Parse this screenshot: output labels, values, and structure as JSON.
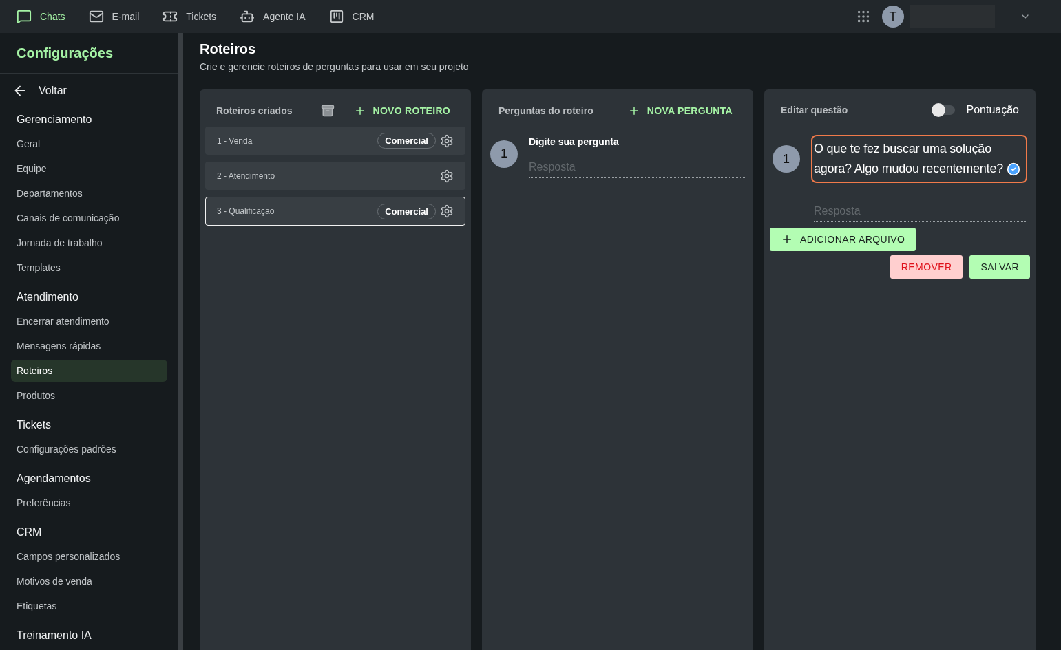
{
  "topnav": [
    {
      "kind": "chats",
      "label": "Chats",
      "selected": true
    },
    {
      "kind": "email",
      "label": "E-mail",
      "selected": false
    },
    {
      "kind": "tickets",
      "label": "Tickets",
      "selected": false
    },
    {
      "kind": "agent",
      "label": "Agente IA",
      "selected": false
    },
    {
      "kind": "crm",
      "label": "CRM",
      "selected": false
    }
  ],
  "user": {
    "initial": "T"
  },
  "sidebar": {
    "title": "Configurações",
    "back": "Voltar",
    "sections": [
      {
        "title": "Gerenciamento",
        "items": [
          {
            "label": "Geral",
            "selected": false
          },
          {
            "label": "Equipe",
            "selected": false
          },
          {
            "label": "Departamentos",
            "selected": false
          },
          {
            "label": "Canais de comunicação",
            "selected": false
          },
          {
            "label": "Jornada de trabalho",
            "selected": false
          },
          {
            "label": "Templates",
            "selected": false
          }
        ]
      },
      {
        "title": "Atendimento",
        "items": [
          {
            "label": "Encerrar atendimento",
            "selected": false
          },
          {
            "label": "Mensagens rápidas",
            "selected": false
          },
          {
            "label": "Roteiros",
            "selected": true
          },
          {
            "label": "Produtos",
            "selected": false
          }
        ]
      },
      {
        "title": "Tickets",
        "items": [
          {
            "label": "Configurações padrões",
            "selected": false
          }
        ]
      },
      {
        "title": "Agendamentos",
        "items": [
          {
            "label": "Preferências",
            "selected": false
          }
        ]
      },
      {
        "title": "CRM",
        "items": [
          {
            "label": "Campos personalizados",
            "selected": false
          },
          {
            "label": "Motivos de venda",
            "selected": false
          },
          {
            "label": "Etiquetas",
            "selected": false
          }
        ]
      },
      {
        "title": "Treinamento IA"
      }
    ]
  },
  "page": {
    "title": "Roteiros",
    "subtitle": "Crie e gerencie roteiros de perguntas para usar em seu projeto"
  },
  "scripts_panel": {
    "title": "Roteiros criados",
    "add": "NOVO ROTEIRO",
    "items": [
      {
        "label": "1 - Venda",
        "tag": "Comercial",
        "selected": false
      },
      {
        "label": "2 - Atendimento",
        "selected": false
      },
      {
        "label": "3 - Qualificação",
        "tag": "Comercial",
        "selected": true
      }
    ]
  },
  "questions_panel": {
    "title": "Perguntas do roteiro",
    "add": "NOVA PERGUNTA",
    "questions": [
      {
        "number": "1",
        "question": "Digite sua pergunta",
        "answer_placeholder": "Resposta"
      }
    ]
  },
  "edit_panel": {
    "title": "Editar questão",
    "toggle": {
      "label": "Pontuação",
      "on": false
    },
    "number": "1",
    "question": "O que te fez buscar uma solução agora? Algo mudou recentemente?",
    "answer_placeholder": "Resposta",
    "attach": "ADICIONAR ARQUIVO",
    "remove": "REMOVER",
    "save": "SALVAR"
  }
}
